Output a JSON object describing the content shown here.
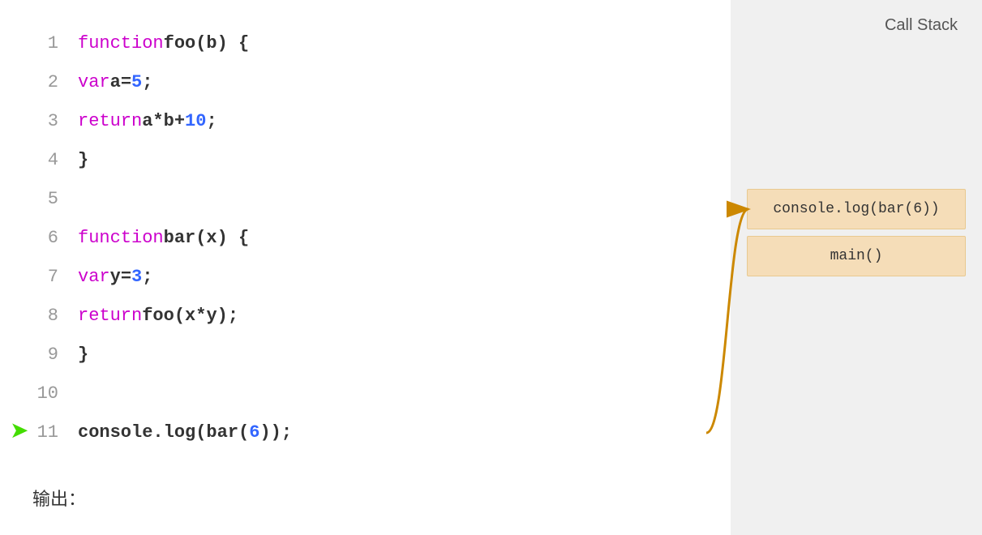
{
  "callstack": {
    "title": "Call Stack",
    "items": [
      {
        "label": "console.log(bar(6))"
      },
      {
        "label": "main()"
      }
    ]
  },
  "code": {
    "lines": [
      {
        "num": 1,
        "tokens": [
          {
            "t": "kw",
            "v": "function"
          },
          {
            "t": "plain",
            "v": " foo(b) {"
          }
        ]
      },
      {
        "num": 2,
        "tokens": [
          {
            "t": "plain",
            "v": "    "
          },
          {
            "t": "var-kw",
            "v": "var"
          },
          {
            "t": "plain",
            "v": " a "
          },
          {
            "t": "op",
            "v": "="
          },
          {
            "t": "plain",
            "v": " "
          },
          {
            "t": "num",
            "v": "5"
          },
          {
            "t": "plain",
            "v": ";"
          }
        ]
      },
      {
        "num": 3,
        "tokens": [
          {
            "t": "plain",
            "v": "    "
          },
          {
            "t": "var-kw",
            "v": "return"
          },
          {
            "t": "plain",
            "v": " a "
          },
          {
            "t": "op",
            "v": "*"
          },
          {
            "t": "plain",
            "v": " b "
          },
          {
            "t": "op",
            "v": "+"
          },
          {
            "t": "plain",
            "v": " "
          },
          {
            "t": "num",
            "v": "10"
          },
          {
            "t": "plain",
            "v": ";"
          }
        ]
      },
      {
        "num": 4,
        "tokens": [
          {
            "t": "plain",
            "v": "}"
          }
        ]
      },
      {
        "num": 5,
        "tokens": []
      },
      {
        "num": 6,
        "tokens": [
          {
            "t": "kw",
            "v": "function"
          },
          {
            "t": "plain",
            "v": " bar(x) {"
          }
        ]
      },
      {
        "num": 7,
        "tokens": [
          {
            "t": "plain",
            "v": "    "
          },
          {
            "t": "var-kw",
            "v": "var"
          },
          {
            "t": "plain",
            "v": " y "
          },
          {
            "t": "op",
            "v": "="
          },
          {
            "t": "plain",
            "v": " "
          },
          {
            "t": "num",
            "v": "3"
          },
          {
            "t": "plain",
            "v": ";"
          }
        ]
      },
      {
        "num": 8,
        "tokens": [
          {
            "t": "plain",
            "v": "    "
          },
          {
            "t": "var-kw",
            "v": "return"
          },
          {
            "t": "plain",
            "v": " foo(x "
          },
          {
            "t": "op",
            "v": "*"
          },
          {
            "t": "plain",
            "v": " y);"
          }
        ]
      },
      {
        "num": 9,
        "tokens": [
          {
            "t": "plain",
            "v": "}"
          }
        ]
      },
      {
        "num": 10,
        "tokens": []
      },
      {
        "num": 11,
        "tokens": [
          {
            "t": "plain",
            "v": "console.log(bar("
          },
          {
            "t": "num",
            "v": "6"
          },
          {
            "t": "plain",
            "v": "));"
          }
        ],
        "current": true
      }
    ]
  },
  "output_label": "输出："
}
